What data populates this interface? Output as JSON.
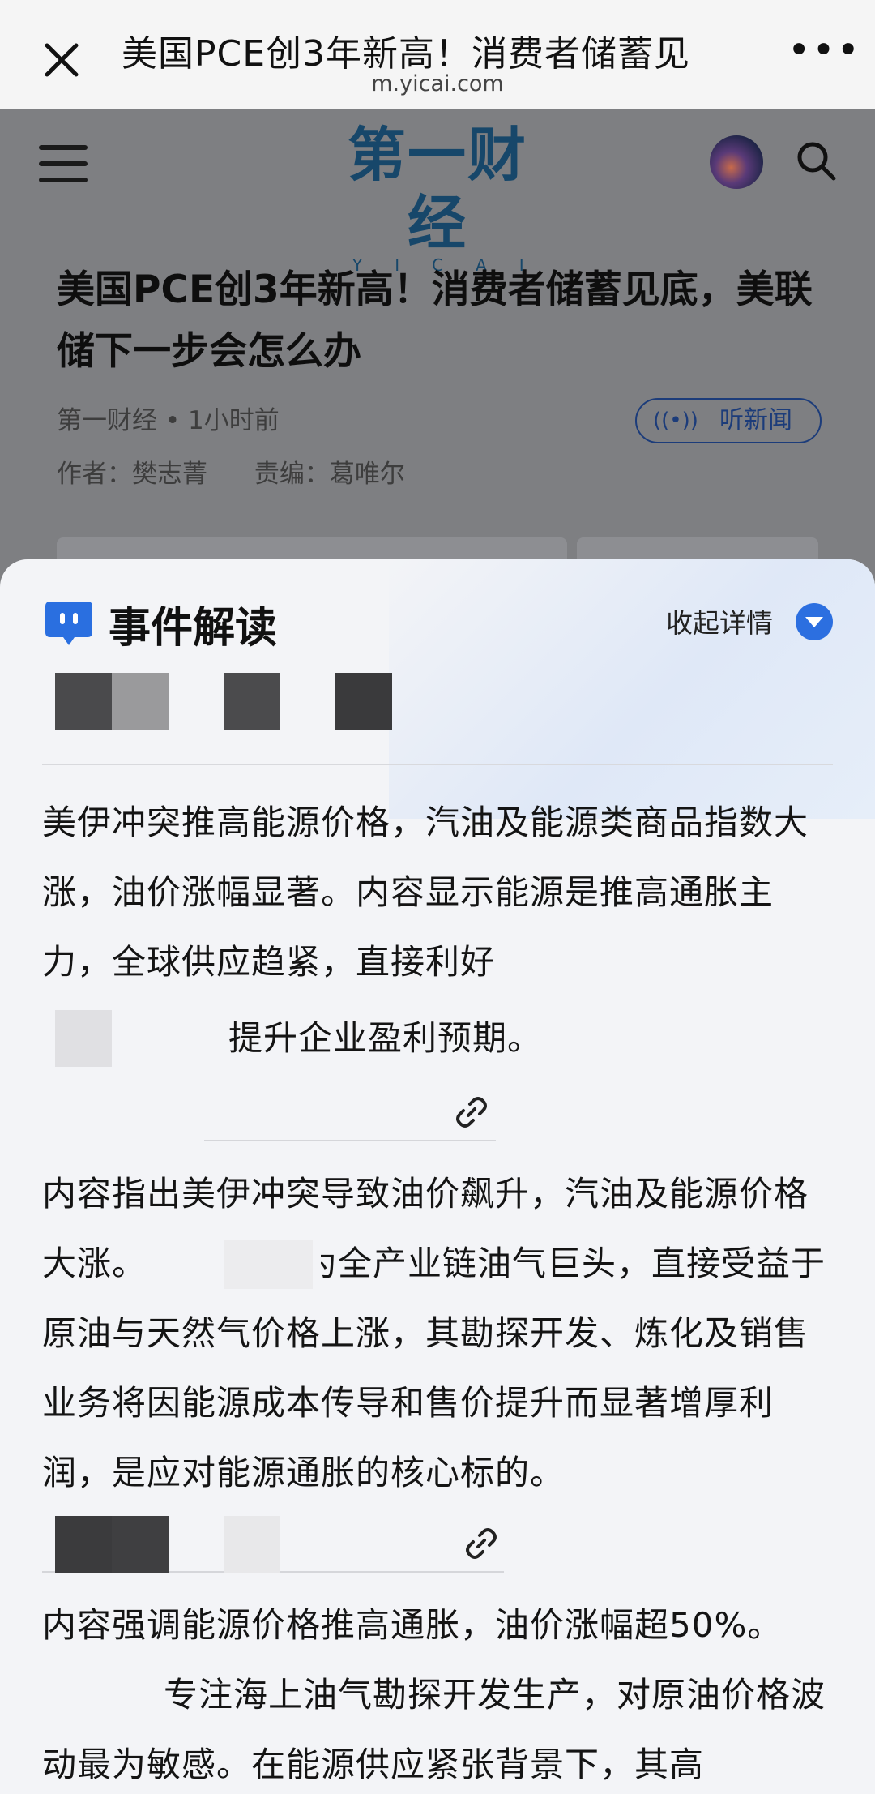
{
  "browser": {
    "title": "美国PCE创3年新高！消费者储蓄见",
    "url": "m.yicai.com"
  },
  "site": {
    "logo_text": "第一财经",
    "logo_sub": "YICAI"
  },
  "article": {
    "headline": "美国PCE创3年新高！消费者储蓄见底，美联储下一步会怎么办",
    "source_time": "第一财经 • 1小时前",
    "listen_label": "听新闻",
    "author": "作者：樊志菁",
    "editor": "责编：葛唯尔"
  },
  "event_panel": {
    "title": "事件解读",
    "collapse_label": "收起详情",
    "summary": "美伊冲突推高能源价格，汽油及能源类商品指数大涨，油价涨幅显著。内容显示能源是推高通胀主力，全球供应趋紧，直接利好",
    "summary_tail": "提升企业盈利预期。",
    "item1_text_a": "内容指出美伊冲突导致油价飙升，汽油及能源价格大涨。",
    "item1_text_b": "作为全产业链油气巨头，直接受益于原油与天然气价格上涨，其勘探开发、炼化及销售业务将因能源成本传导和售价提升而显著增厚利润，是应对能源通胀的核心标的。",
    "item2_text_a": "内容强调能源价格推高通胀，油价涨幅超50%。",
    "item2_text_b": "专注海上油气勘探开发生产，对原油价格波动最为敏感。在能源供应紧张背景下，其高"
  }
}
